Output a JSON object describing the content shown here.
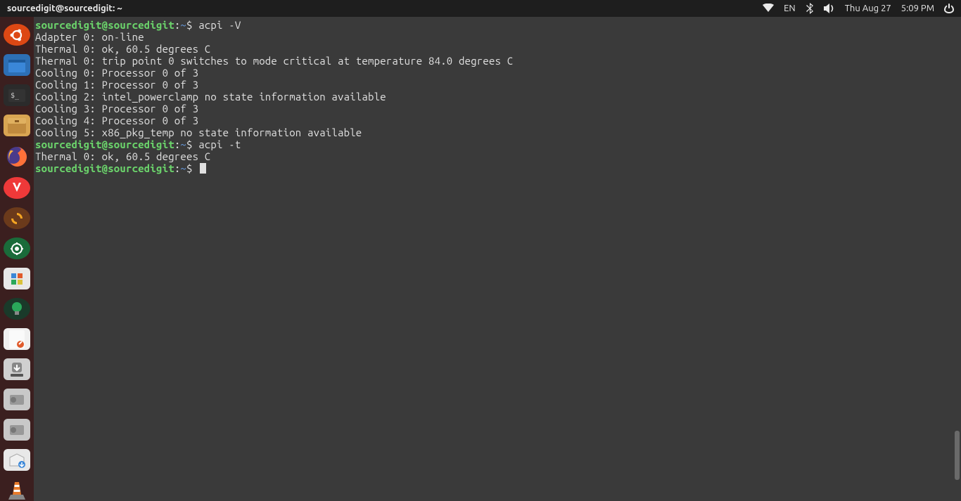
{
  "topbar": {
    "title": "sourcedigit@sourcedigit: ~",
    "lang": "EN",
    "date": "Thu Aug 27",
    "time": "5:09 PM"
  },
  "dock": {
    "items": [
      {
        "name": "ubuntu-launcher"
      },
      {
        "name": "files"
      },
      {
        "name": "terminal"
      },
      {
        "name": "archive-manager"
      },
      {
        "name": "firefox"
      },
      {
        "name": "vivaldi"
      },
      {
        "name": "sync-app"
      },
      {
        "name": "screenshot"
      },
      {
        "name": "settings-tool"
      },
      {
        "name": "lightbulb-app"
      },
      {
        "name": "notes-app"
      },
      {
        "name": "downloads"
      },
      {
        "name": "disk-utility-1"
      },
      {
        "name": "disk-utility-2"
      },
      {
        "name": "software-center"
      },
      {
        "name": "vlc"
      }
    ]
  },
  "terminal": {
    "prompt": {
      "user_host": "sourcedigit@sourcedigit",
      "path": "~",
      "symbol": "$"
    },
    "sessions": [
      {
        "command": "acpi -V",
        "output": [
          "Adapter 0: on-line",
          "Thermal 0: ok, 60.5 degrees C",
          "Thermal 0: trip point 0 switches to mode critical at temperature 84.0 degrees C",
          "Cooling 0: Processor 0 of 3",
          "Cooling 1: Processor 0 of 3",
          "Cooling 2: intel_powerclamp no state information available",
          "Cooling 3: Processor 0 of 3",
          "Cooling 4: Processor 0 of 3",
          "Cooling 5: x86_pkg_temp no state information available"
        ]
      },
      {
        "command": "acpi -t",
        "output": [
          "Thermal 0: ok, 60.5 degrees C"
        ]
      }
    ]
  }
}
